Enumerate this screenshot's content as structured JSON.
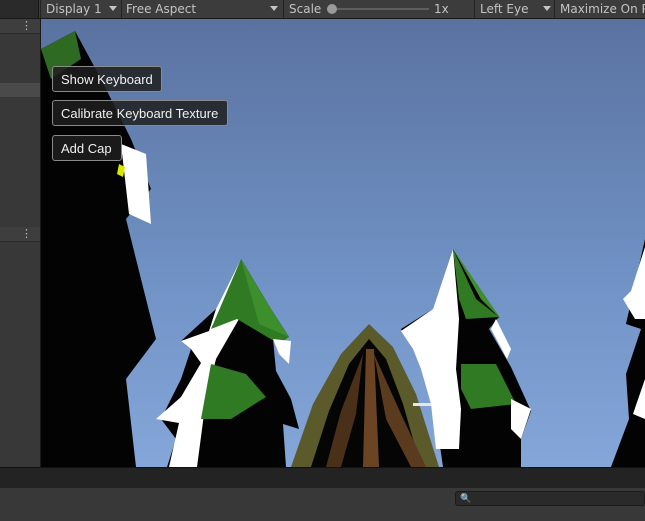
{
  "toolbar": {
    "display": "Display 1",
    "aspect": "Free Aspect",
    "scale_label": "Scale",
    "scale_value": "1x",
    "scale_slider_position": 0.0,
    "eye": "Left Eye",
    "maximize": "Maximize On Play"
  },
  "game_ui": {
    "buttons": [
      {
        "label": "Show Keyboard"
      },
      {
        "label": "Calibrate Keyboard Texture"
      },
      {
        "label": "Add Cap"
      }
    ]
  },
  "colors": {
    "sky_top": "#5a72a0",
    "sky_bottom": "#7fa1d3",
    "tree_green": "#2f7a22",
    "snow": "#ffffff",
    "cabin_roof": "#5b5a2b"
  },
  "search": {
    "icon": "search-icon"
  }
}
